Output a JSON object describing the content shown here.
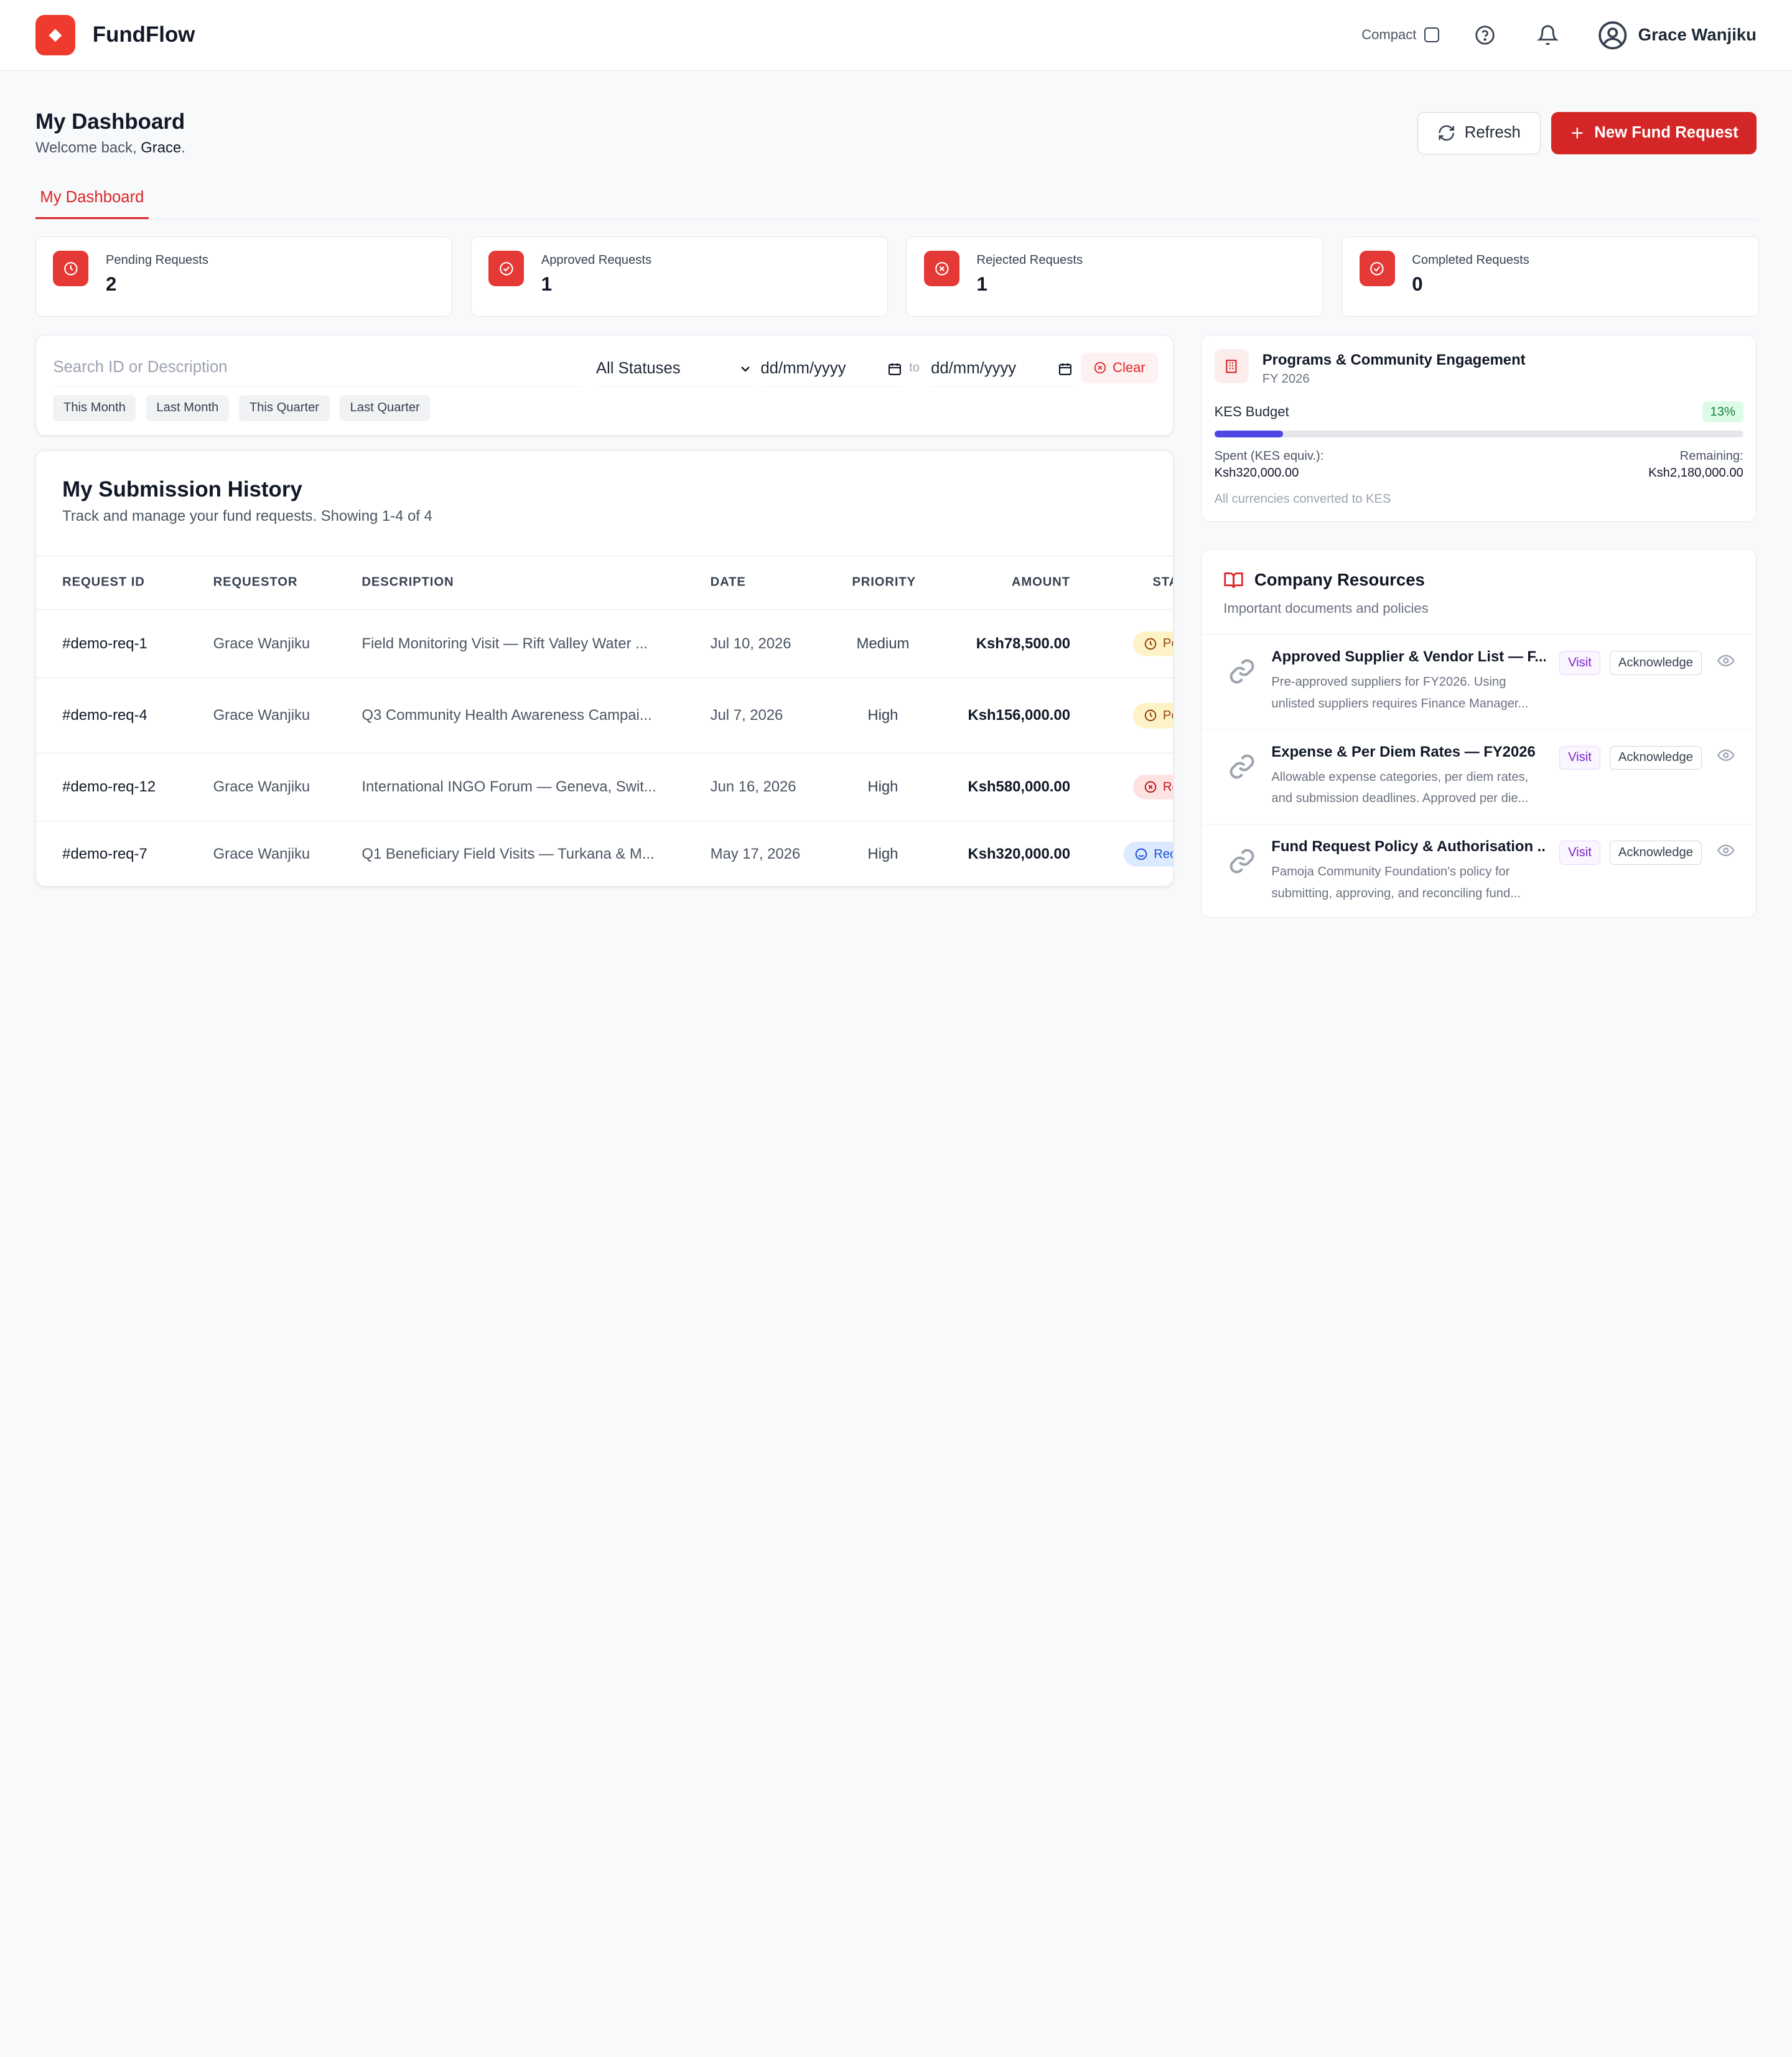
{
  "app": {
    "name": "FundFlow",
    "brand_color": "#ef3b2d"
  },
  "header": {
    "compact_label": "Compact",
    "compact_checked": false,
    "user_name": "Grace Wanjiku",
    "icons": [
      "help-circle-icon",
      "bell-icon",
      "user-circle-icon"
    ]
  },
  "page": {
    "title": "My Dashboard",
    "welcome_prefix": "Welcome back, ",
    "welcome_name": "Grace",
    "welcome_suffix": ".",
    "refresh_label": "Refresh",
    "new_request_label": "New Fund Request"
  },
  "tabs": [
    {
      "label": "My Dashboard",
      "active": true
    }
  ],
  "stats": [
    {
      "label": "Pending Requests",
      "value": "2",
      "icon": "clock-icon"
    },
    {
      "label": "Approved Requests",
      "value": "1",
      "icon": "check-circle-icon"
    },
    {
      "label": "Rejected Requests",
      "value": "1",
      "icon": "x-circle-icon"
    },
    {
      "label": "Completed Requests",
      "value": "0",
      "icon": "check-circle-icon"
    }
  ],
  "filters": {
    "search_placeholder": "Search ID or Description",
    "status_value": "All Statuses",
    "date_from_placeholder": "dd/mm/yyyy",
    "date_to_placeholder": "dd/mm/yyyy",
    "to_label": "to",
    "clear_label": "Clear",
    "quick_ranges": [
      "This Month",
      "Last Month",
      "This Quarter",
      "Last Quarter"
    ]
  },
  "history": {
    "title": "My Submission History",
    "subtitle": "Track and manage your fund requests. Showing 1-4 of 4",
    "columns": [
      "REQUEST ID",
      "REQUESTOR",
      "DESCRIPTION",
      "DATE",
      "PRIORITY",
      "AMOUNT",
      "STA"
    ],
    "rows": [
      {
        "id": "#demo-req-1",
        "requestor": "Grace Wanjiku",
        "description": "Field Monitoring Visit — Rift Valley Water ...",
        "date": "Jul 10, 2026",
        "priority": "Medium",
        "amount": "Ksh78,500.00",
        "status": "Pe",
        "status_type": "pending"
      },
      {
        "id": "#demo-req-4",
        "requestor": "Grace Wanjiku",
        "description": "Q3 Community Health Awareness Campai...",
        "date": "Jul 7, 2026",
        "priority": "High",
        "amount": "Ksh156,000.00",
        "status": "Pe",
        "status_type": "pending"
      },
      {
        "id": "#demo-req-12",
        "requestor": "Grace Wanjiku",
        "description": "International INGO Forum — Geneva, Swit...",
        "date": "Jun 16, 2026",
        "priority": "High",
        "amount": "Ksh580,000.00",
        "status": "Re",
        "status_type": "rejected"
      },
      {
        "id": "#demo-req-7",
        "requestor": "Grace Wanjiku",
        "description": "Q1 Beneficiary Field Visits — Turkana & M...",
        "date": "May 17, 2026",
        "priority": "High",
        "amount": "Ksh320,000.00",
        "status": "Rec",
        "status_type": "received"
      }
    ]
  },
  "budget": {
    "department": "Programs & Community Engagement",
    "year": "FY 2026",
    "label": "KES Budget",
    "percent_label": "13%",
    "percent_used": 13,
    "spent_label": "Spent (KES equiv.):",
    "spent_value": "Ksh320,000.00",
    "remaining_label": "Remaining:",
    "remaining_value": "Ksh2,180,000.00",
    "note": "All currencies converted to KES",
    "bar_color": "#4f46e5"
  },
  "resources": {
    "title": "Company Resources",
    "subtitle": "Important documents and policies",
    "visit_label": "Visit",
    "ack_label": "Acknowledge",
    "items": [
      {
        "name": "Approved Supplier & Vendor List — F...",
        "description": "Pre-approved suppliers for FY2026. Using unlisted suppliers requires Finance Manager..."
      },
      {
        "name": "Expense & Per Diem Rates — FY2026",
        "description": "Allowable expense categories, per diem rates, and submission deadlines. Approved per die..."
      },
      {
        "name": "Fund Request Policy & Authorisation ...",
        "description": "Pamoja Community Foundation's policy for submitting, approving, and reconciling fund..."
      }
    ]
  }
}
